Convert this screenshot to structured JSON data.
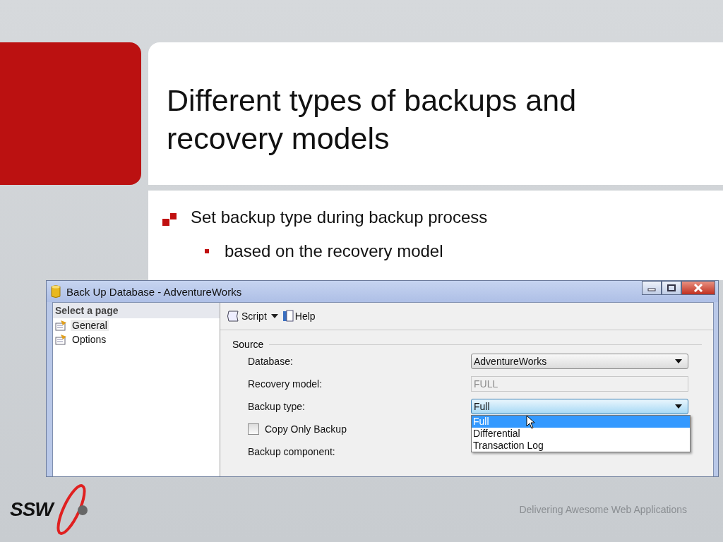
{
  "slide": {
    "title": "Different types of backups and recovery models",
    "bullets": [
      {
        "text": "Set backup type during backup process",
        "children": [
          {
            "text": "based on the recovery model"
          }
        ]
      }
    ]
  },
  "dialog": {
    "title": "Back Up Database - AdventureWorks",
    "page_list": {
      "header": "Select a page",
      "items": [
        {
          "label": "General",
          "selected": true
        },
        {
          "label": "Options",
          "selected": false
        }
      ]
    },
    "toolbar": [
      {
        "label": "Script",
        "kind": "script"
      },
      {
        "label": "Help",
        "kind": "help"
      }
    ],
    "section": "Source",
    "fields": [
      {
        "label": "Database:",
        "kind": "combo",
        "value": "AdventureWorks",
        "expanded": false
      },
      {
        "label": "Recovery model:",
        "kind": "text",
        "value": "FULL",
        "disabled": true
      },
      {
        "label": "Backup type:",
        "kind": "combo",
        "value": "Full",
        "expanded": true
      },
      {
        "label": "Copy Only Backup",
        "kind": "checkbox",
        "checked": false
      },
      {
        "label": "Backup component:",
        "kind": "label"
      }
    ],
    "dropdown_options": [
      {
        "label": "Full",
        "selected": true
      },
      {
        "label": "Differential",
        "selected": false
      },
      {
        "label": "Transaction Log",
        "selected": false
      }
    ]
  },
  "footer": {
    "logo": "SSW",
    "tagline": "Delivering Awesome Web Applications"
  }
}
